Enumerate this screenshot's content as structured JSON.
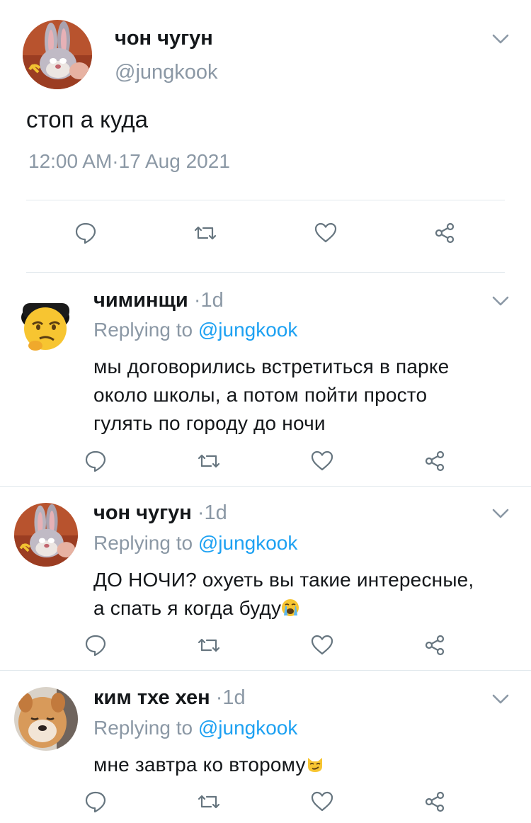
{
  "main_tweet": {
    "display_name": "чон чугун",
    "handle": "@jungkook",
    "text": "стоп а куда",
    "timestamp": "12:00 AM·17 Aug 2021"
  },
  "replies": [
    {
      "display_name": "чиминщи",
      "time": "·1d",
      "replying_prefix": "Replying to",
      "replying_handle": "@jungkook",
      "lines": [
        "мы договорились встретиться в парке",
        "около школы, а потом пойти просто",
        "гулять по городу до ночи"
      ]
    },
    {
      "display_name": "чон чугун",
      "time": "·1d",
      "replying_prefix": "Replying to",
      "replying_handle": "@jungkook",
      "lines": [
        "ДО НОЧИ? охуеть вы такие интересные,",
        "а спать я когда буду"
      ],
      "emoji": "loudly-crying-face"
    },
    {
      "display_name": "ким тхе хен",
      "time": "·1d",
      "replying_prefix": "Replying to",
      "replying_handle": "@jungkook",
      "lines": [
        "мне завтра ко второму"
      ],
      "emoji": "smirking-cat-face"
    }
  ],
  "colors": {
    "text": "#14171a",
    "secondary": "#8b98a5",
    "accent": "#1da1f2",
    "icon": "#66757f",
    "divider": "#e1e8ed"
  }
}
